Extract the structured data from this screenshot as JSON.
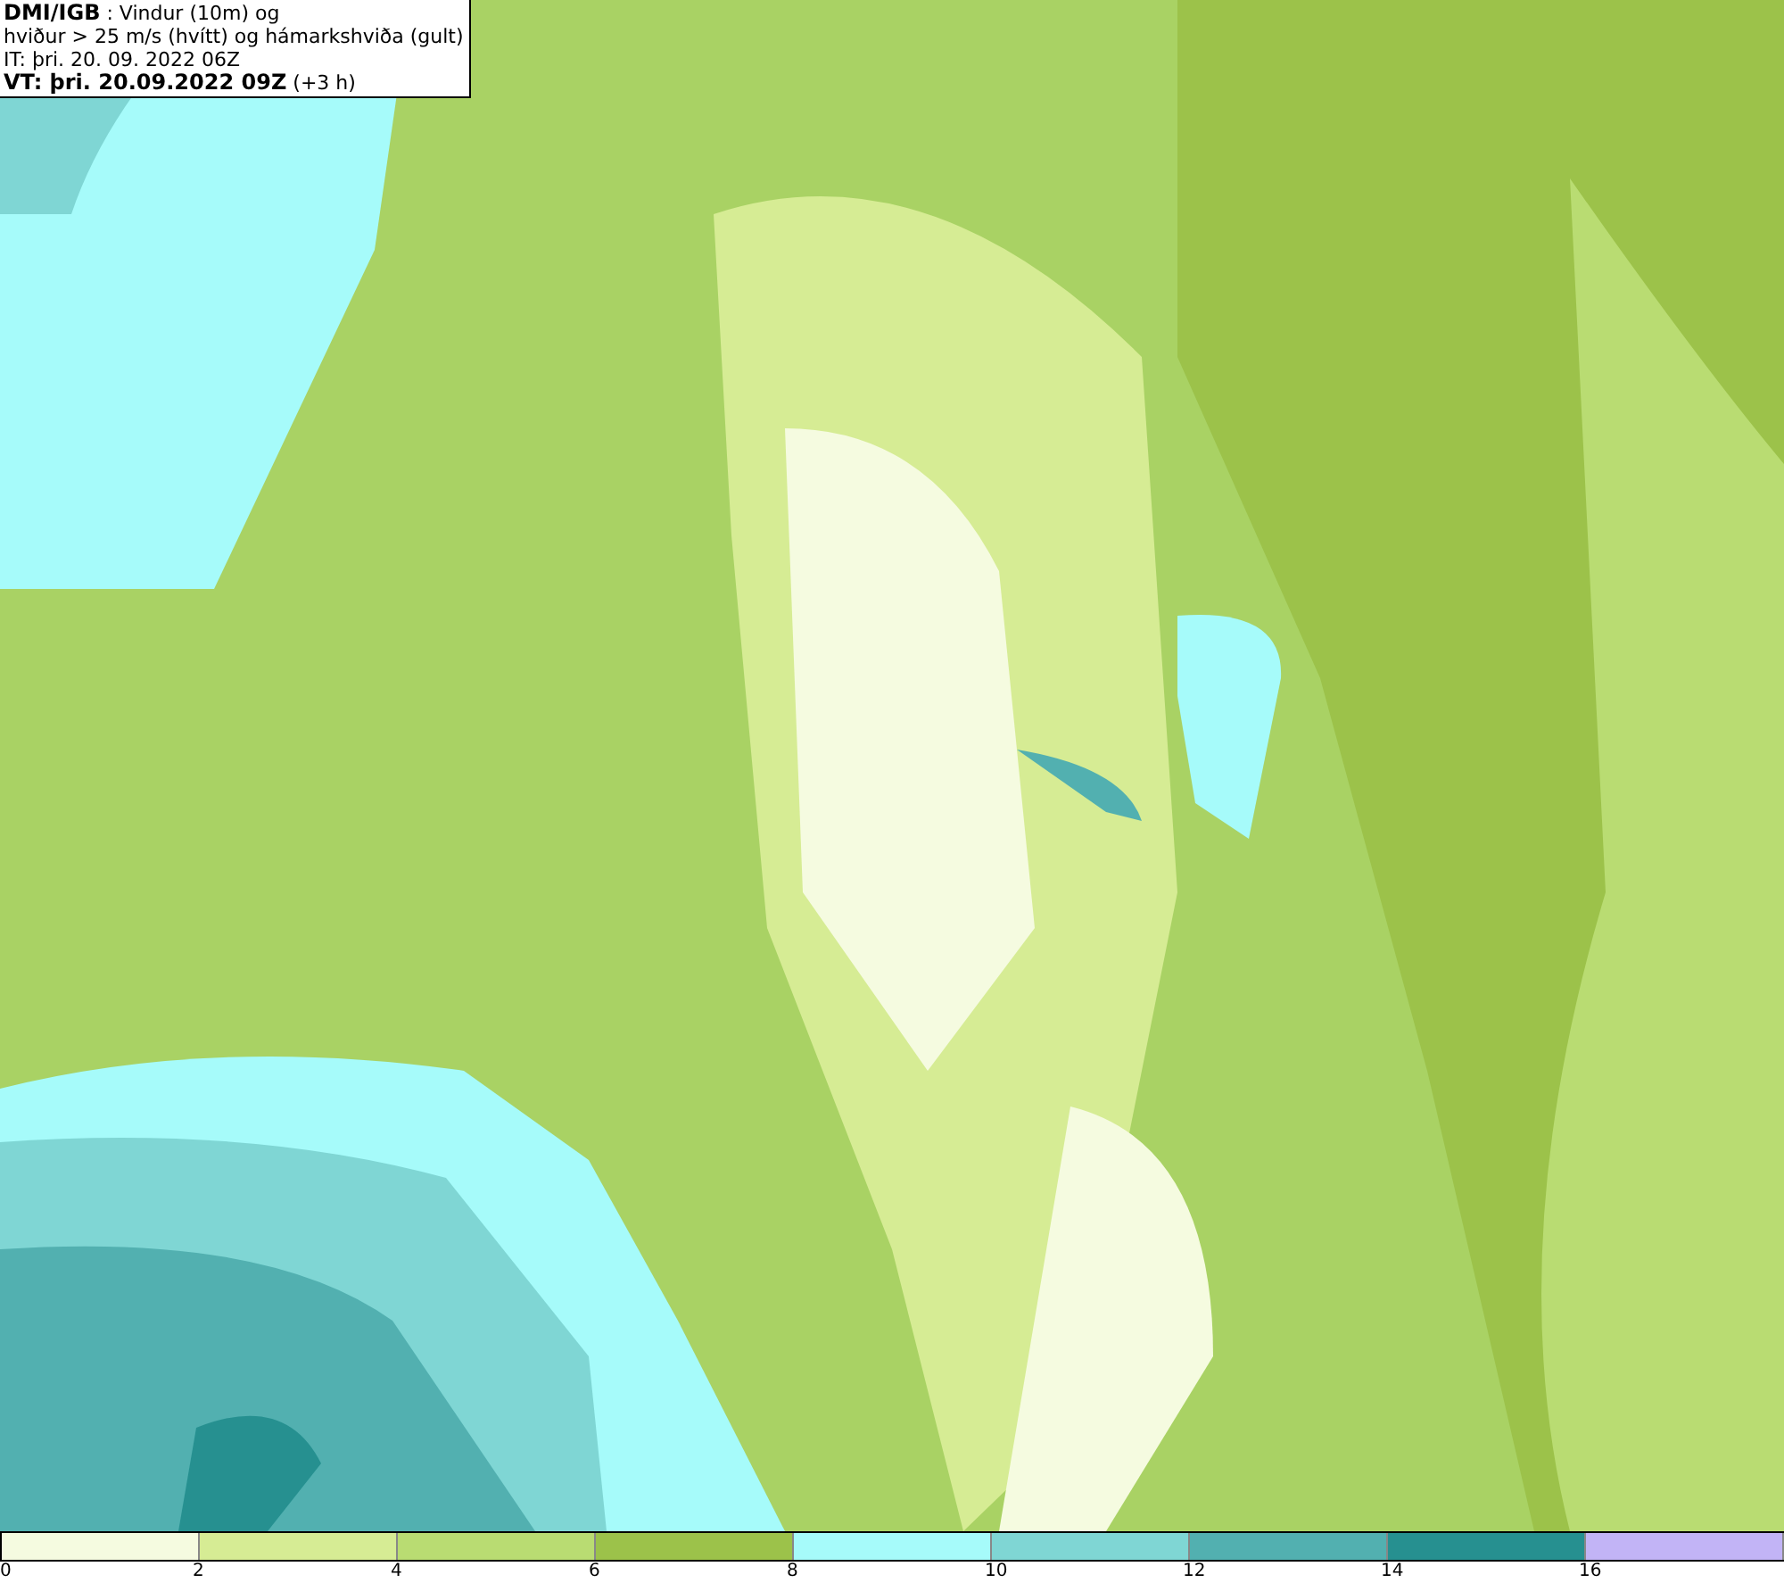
{
  "header": {
    "lines": [
      "**DMI/IGB** : Vindur (10m) og",
      "hviður > 25 m/s (hvítt) og hámarkshviða (gult)",
      "IT: þri. 20. 09. 2022 06Z",
      "**VT: þri. 20.09.2022 09Z** (+3 h)"
    ]
  },
  "legend": {
    "bins": [
      {
        "color": "#f5fbe0"
      },
      {
        "color": "#d6ec94"
      },
      {
        "color": "#b9dc72"
      },
      {
        "color": "#9cc24a"
      },
      {
        "color": "#a6fbfa"
      },
      {
        "color": "#7fd6d4"
      },
      {
        "color": "#52b0b0"
      },
      {
        "color": "#269090"
      },
      {
        "color": "#c2b4f6"
      }
    ],
    "labels": [
      "0",
      "2",
      "4",
      "6",
      "8",
      "10",
      "12",
      "14",
      "16"
    ]
  }
}
